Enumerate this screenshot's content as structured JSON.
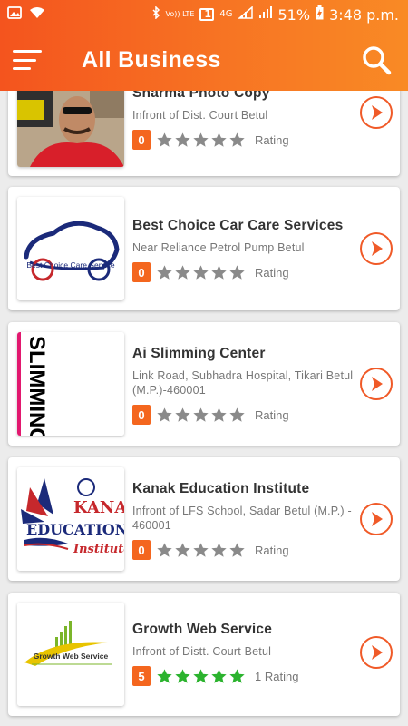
{
  "status_bar": {
    "network_label": "Vo)) LTE",
    "sim_label": "1",
    "network_type": "4G",
    "battery": "51%",
    "time": "3:48 p.m."
  },
  "app_bar": {
    "title": "All Business",
    "menu_icon": "hamburger-menu-icon",
    "search_icon": "search-icon"
  },
  "colors": {
    "accent": "#f4661e",
    "star_filled": "#2bb32e",
    "star_empty": "#8a8a8a"
  },
  "businesses": [
    {
      "name": "Sharma Photo Copy",
      "address": "Infront of Dist. Court Betul",
      "rating": "0",
      "rating_value": 0,
      "rating_label": "Rating"
    },
    {
      "name": "Best Choice Car Care Services",
      "address": "Near Reliance Petrol Pump Betul",
      "rating": "0",
      "rating_value": 0,
      "rating_label": "Rating",
      "logo_text": "Best Choice Care Service"
    },
    {
      "name": "Ai Slimming Center",
      "address": "Link Road, Subhadra Hospital, Tikari Betul (M.P.)-460001",
      "rating": "0",
      "rating_value": 0,
      "rating_label": "Rating",
      "logo_text": "SLIMMING CENTER"
    },
    {
      "name": "Kanak Education Institute",
      "address": "Infront of LFS School, Sadar Betul (M.P.) - 460001",
      "rating": "0",
      "rating_value": 0,
      "rating_label": "Rating",
      "logo_text": "KANAK EDUCATION Institute"
    },
    {
      "name": "Growth Web Service",
      "address": "Infront of Distt. Court Betul",
      "rating": "5",
      "rating_value": 5,
      "rating_label": "1 Rating",
      "logo_text": "Growth Web Service"
    }
  ]
}
